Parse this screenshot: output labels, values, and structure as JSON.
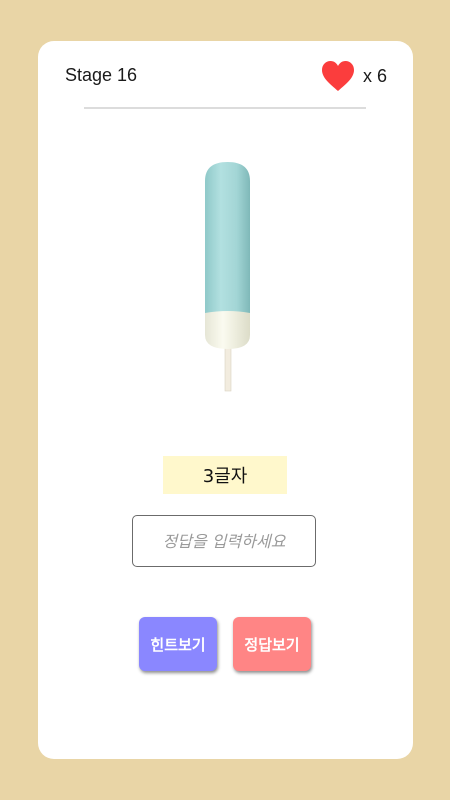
{
  "header": {
    "stage_label": "Stage 16",
    "lives_text": "x 6",
    "heart_color": "#fb3d3d"
  },
  "puzzle": {
    "image": "popsicle",
    "hint_text": "3글자"
  },
  "answer": {
    "placeholder": "정답을 입력하세요",
    "value": ""
  },
  "buttons": {
    "hint_label": "힌트보기",
    "reveal_label": "정답보기"
  },
  "colors": {
    "background": "#e9d5a6",
    "card": "#ffffff",
    "hint_box": "#fff8cc",
    "hint_button": "#8a87ff",
    "reveal_button": "#ff8585"
  }
}
